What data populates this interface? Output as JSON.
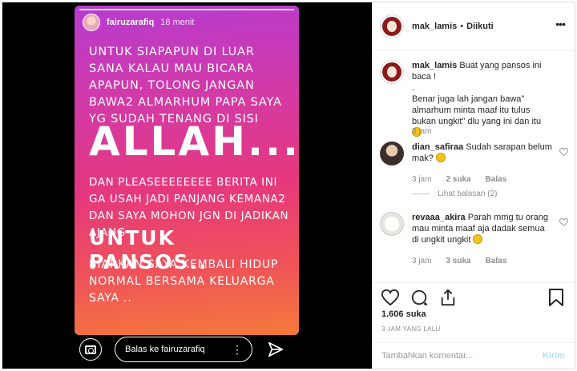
{
  "story": {
    "user": "fairuzarafiq",
    "time": "18 menit",
    "text1": "UNTUK SIAPAPUN DI LUAR SANA KALAU MAU BICARA APAPUN, TOLONG JANGAN BAWA2 ALMARHUM PAPA SAYA YG SUDAH TENANG DI SISI",
    "text2": "ALLAH...",
    "text3": "DAN PLEASEEEEEEEE BERITA INI GA USAH JADI PANJANG KEMANA2 DAN SAYA MOHON JGN DI JADIKAN AJANG",
    "text4": "UNTUK PANSOS..",
    "text5": "BIARKAN SAYA KEMBALI HIDUP NORMAL BERSAMA KELUARGA SAYA ..",
    "reply_placeholder": "Balas ke fairuzarafiq"
  },
  "header": {
    "username": "mak_lamis",
    "separator": "•",
    "follow_status": "Diikuti"
  },
  "caption": {
    "username": "mak_lamis",
    "line1": "Buat yang pansos ini baca !",
    "line2": ".",
    "line3": "Benar juga lah jangan bawa\" almarhum minta maaf itu tulus bukan ungkit\" dlu yang ini dan itu",
    "time": "3 jam"
  },
  "comments": [
    {
      "username": "dian_safiraa",
      "text": "Sudah sarapan belum mak?",
      "time": "3 jam",
      "likes": "2 suka",
      "reply": "Balas",
      "view_replies": "Lihat balasan (2)"
    },
    {
      "username": "revaaa_akira",
      "text": "Parah mmg tu orang mau minta maaf aja dadak semua di ungkit ungkit",
      "time": "3 jam",
      "likes": "3 suka",
      "reply": "Balas"
    }
  ],
  "post": {
    "likes": "1.606 suka",
    "posted": "3 JAM YANG LALU",
    "add_comment_placeholder": "Tambahkan komentar...",
    "post_button": "Kirim"
  },
  "colors": {
    "story_gradient_start": "#b73bd0",
    "story_gradient_end": "#f57a3a",
    "post_button": "#b2dffc"
  }
}
